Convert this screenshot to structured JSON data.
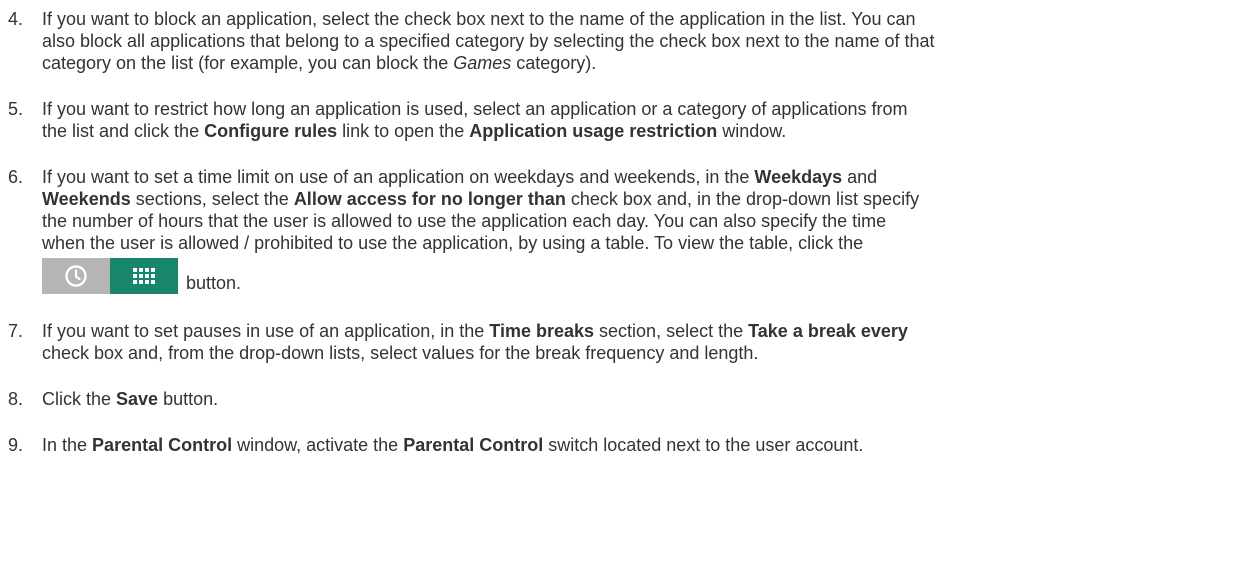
{
  "steps": [
    {
      "number": "4.",
      "lines": [
        [
          {
            "t": "If you want to block an application, select the check box next to the name of the application in the list. You can",
            "s": ""
          }
        ],
        [
          {
            "t": "also block all applications that belong to a specified category by selecting the check box next to the name of that",
            "s": ""
          }
        ],
        [
          {
            "t": "category on the list (for example, you can block the ",
            "s": ""
          },
          {
            "t": "Games",
            "s": "i"
          },
          {
            "t": " category).",
            "s": ""
          }
        ]
      ]
    },
    {
      "number": "5.",
      "lines": [
        [
          {
            "t": "If you want to restrict how long an application is used, select an application or a category of applications from",
            "s": ""
          }
        ],
        [
          {
            "t": "the list and click the ",
            "s": ""
          },
          {
            "t": "Configure rules",
            "s": "b"
          },
          {
            "t": " link to open the ",
            "s": ""
          },
          {
            "t": "Application usage restriction",
            "s": "b"
          },
          {
            "t": " window.",
            "s": ""
          }
        ]
      ]
    },
    {
      "number": "6.",
      "lines": [
        [
          {
            "t": "If you want to set a time limit on use of an application on weekdays and weekends, in the ",
            "s": ""
          },
          {
            "t": "Weekdays",
            "s": "b"
          },
          {
            "t": " and",
            "s": ""
          }
        ],
        [
          {
            "t": "Weekends",
            "s": "b"
          },
          {
            "t": " sections, select the ",
            "s": ""
          },
          {
            "t": "Allow access for no longer than",
            "s": "b"
          },
          {
            "t": " check box and, in the drop-down list specify",
            "s": ""
          }
        ],
        [
          {
            "t": "the number of hours that the user is allowed to use the application each day. You can also specify the time",
            "s": ""
          }
        ],
        [
          {
            "t": "when the user is allowed / prohibited to use the application, by using a table. To view the table, click the",
            "s": ""
          }
        ]
      ],
      "button_suffix": "button."
    },
    {
      "number": "7.",
      "lines": [
        [
          {
            "t": "If you want to set pauses in use of an application, in the ",
            "s": ""
          },
          {
            "t": "Time breaks",
            "s": "b"
          },
          {
            "t": " section, select the ",
            "s": ""
          },
          {
            "t": "Take a break every",
            "s": "b"
          }
        ],
        [
          {
            "t": "check box and, from the drop-down lists, select values for the break frequency and length.",
            "s": ""
          }
        ]
      ]
    },
    {
      "number": "8.",
      "lines": [
        [
          {
            "t": "Click the ",
            "s": ""
          },
          {
            "t": "Save",
            "s": "b"
          },
          {
            "t": " button.",
            "s": ""
          }
        ]
      ]
    },
    {
      "number": "9.",
      "lines": [
        [
          {
            "t": "In the ",
            "s": ""
          },
          {
            "t": "Parental Control",
            "s": "b"
          },
          {
            "t": " window, activate the ",
            "s": ""
          },
          {
            "t": "Parental Control",
            "s": "b"
          },
          {
            "t": " switch located next to the user account.",
            "s": ""
          }
        ]
      ]
    }
  ],
  "view_toggle": {
    "left_icon": "clock-icon",
    "right_icon": "grid-table-icon",
    "left_color": "#b5b5b5",
    "right_color": "#17866a"
  }
}
